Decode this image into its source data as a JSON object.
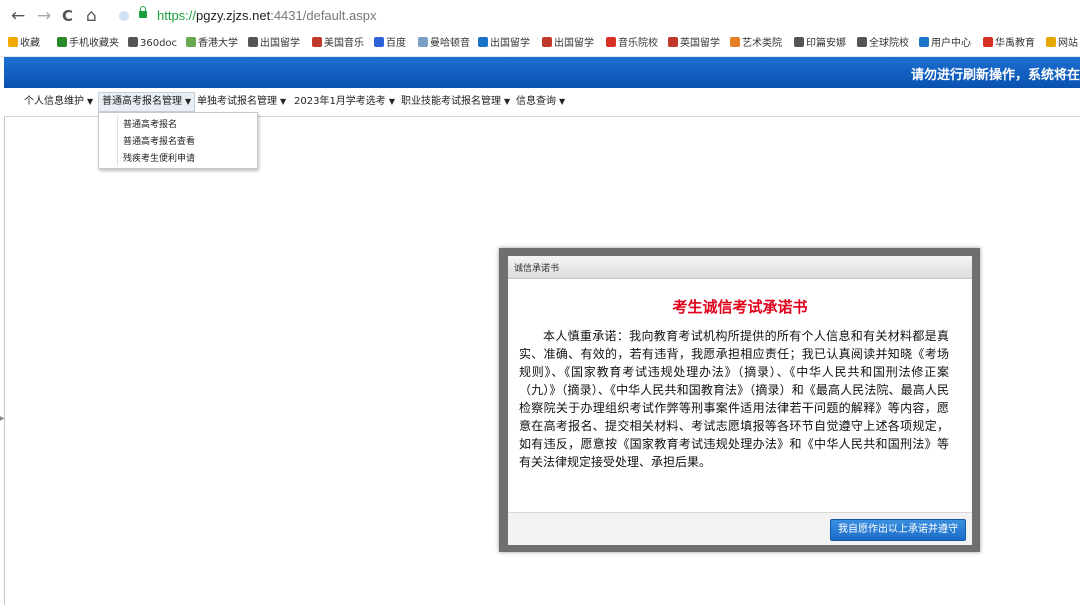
{
  "browser": {
    "url_scheme": "https://",
    "url_host": "pgzy.zjzs.net",
    "url_rest": ":4431/default.aspx",
    "back": "←",
    "forward": "→",
    "reload": "C",
    "home": "⌂"
  },
  "bookmarks": {
    "items": [
      {
        "label": "收藏",
        "icon": "star-icon",
        "color": "#f2a900"
      },
      {
        "label": "手机收藏夹",
        "icon": "phone-icon",
        "color": "#2a8a2a"
      },
      {
        "label": "360doc",
        "icon": "globe-icon",
        "color": "#555555"
      },
      {
        "label": "香港大学",
        "icon": "flower-icon",
        "color": "#6aa84f"
      },
      {
        "label": "出国留学",
        "icon": "globe-icon",
        "color": "#555555"
      },
      {
        "label": "美国音乐",
        "icon": "logo-icon",
        "color": "#c0392b"
      },
      {
        "label": "百度",
        "icon": "paw-icon",
        "color": "#2f62d9"
      },
      {
        "label": "曼哈顿音",
        "icon": "leaf-icon",
        "color": "#7aa0c4"
      },
      {
        "label": "出国留学",
        "icon": "diamond-icon",
        "color": "#1a73c9"
      },
      {
        "label": "出国留学",
        "icon": "cap-icon",
        "color": "#c0392b"
      },
      {
        "label": "音乐院校",
        "icon": "circle-icon",
        "color": "#d93025"
      },
      {
        "label": "英国留学",
        "icon": "logo-icon",
        "color": "#c0392b"
      },
      {
        "label": "艺术类院",
        "icon": "logo-icon",
        "color": "#e67e22"
      },
      {
        "label": "印篇安娜",
        "icon": "square-icon",
        "color": "#555555"
      },
      {
        "label": "全球院校",
        "icon": "globe-icon",
        "color": "#555555"
      },
      {
        "label": "用户中心",
        "icon": "circle-icon",
        "color": "#1a73c9"
      },
      {
        "label": "华禹教育",
        "icon": "diamond-icon",
        "color": "#d93025"
      },
      {
        "label": "网站",
        "icon": "square-icon",
        "color": "#e6a700"
      }
    ]
  },
  "banner": {
    "text": "请勿进行刷新操作，系统将在"
  },
  "menu": {
    "items": [
      {
        "label": "个人信息维护"
      },
      {
        "label": "普通高考报名管理"
      },
      {
        "label": "单独考试报名管理"
      },
      {
        "label": "2023年1月学考选考"
      },
      {
        "label": "职业技能考试报名管理"
      },
      {
        "label": "信息查询"
      }
    ],
    "dropdown": [
      {
        "label": "普通高考报名"
      },
      {
        "label": "普通高考报名查看"
      },
      {
        "label": "残疾考生便利申请"
      }
    ]
  },
  "modal": {
    "header": "诚信承诺书",
    "title": "考生诚信考试承诺书",
    "body": "本人慎重承诺：我向教育考试机构所提供的所有个人信息和有关材料都是真实、准确、有效的，若有违背，我愿承担相应责任；我已认真阅读并知晓《考场规则》、《国家教育考试违规处理办法》（摘录）、《中华人民共和国刑法修正案（九）》（摘录）、《中华人民共和国教育法》（摘录）和《最高人民法院、最高人民检察院关于办理组织考试作弊等刑事案件适用法律若干问题的解释》等内容，愿意在高考报名、提交相关材料、考试志愿填报等各环节自觉遵守上述各项规定，如有违反，愿意按《国家教育考试违规处理办法》和《中华人民共和国刑法》等有关法律规定接受处理、承担后果。",
    "agree_button": "我自愿作出以上承诺并遵守"
  }
}
